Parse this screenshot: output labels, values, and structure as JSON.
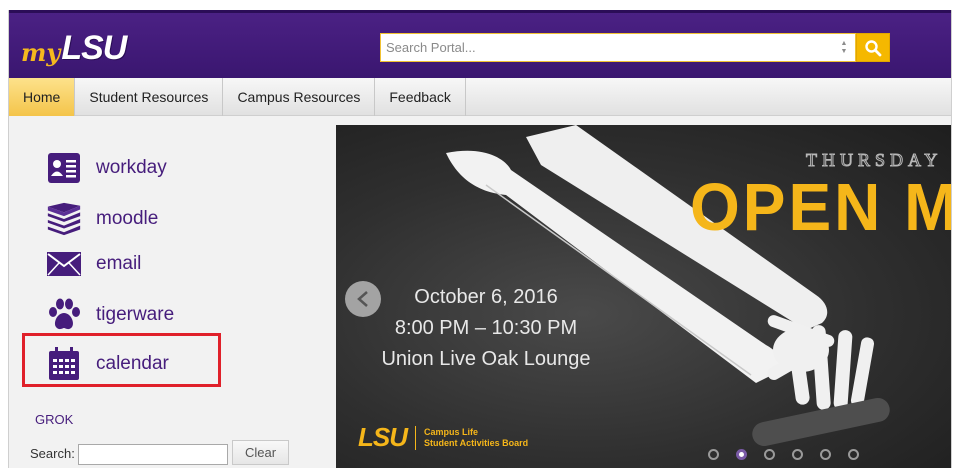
{
  "header": {
    "logo_my": "my",
    "logo_lsu": "LSU",
    "search_placeholder": "Search Portal..."
  },
  "nav": {
    "tabs": [
      {
        "label": "Home",
        "active": true
      },
      {
        "label": "Student Resources",
        "active": false
      },
      {
        "label": "Campus Resources",
        "active": false
      },
      {
        "label": "Feedback",
        "active": false
      }
    ]
  },
  "apps": [
    {
      "label": "workday",
      "icon": "id-card-icon"
    },
    {
      "label": "moodle",
      "icon": "books-icon"
    },
    {
      "label": "email",
      "icon": "envelope-icon"
    },
    {
      "label": "tigerware",
      "icon": "paw-icon"
    },
    {
      "label": "calendar",
      "icon": "calendar-icon"
    }
  ],
  "grok": {
    "title": "GROK",
    "search_label": "Search:",
    "search_value": "",
    "clear_label": "Clear"
  },
  "carousel": {
    "day_text": "THURSDAY N",
    "title": "OPEN MI",
    "date": "October 6, 2016",
    "time": "8:00 PM – 10:30 PM",
    "location": "Union Live Oak Lounge",
    "footer_logo": "LSU",
    "footer_line1": "Campus Life",
    "footer_line2": "Student Activities Board",
    "slide_count": 6,
    "active_slide": 2
  },
  "colors": {
    "purple": "#461d7c",
    "gold": "#f5b61a",
    "highlight": "#e0202a"
  }
}
